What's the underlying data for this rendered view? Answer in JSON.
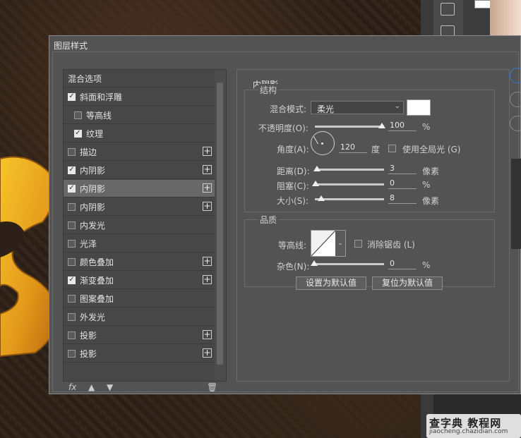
{
  "dialog": {
    "title": "图层样式"
  },
  "style_list": {
    "header": "混合选项",
    "items": [
      {
        "label": "斜面和浮雕",
        "checked": true,
        "plus": false,
        "indent": 0,
        "selected": false
      },
      {
        "label": "等高线",
        "checked": false,
        "plus": false,
        "indent": 1,
        "selected": false
      },
      {
        "label": "纹理",
        "checked": true,
        "plus": false,
        "indent": 1,
        "selected": false
      },
      {
        "label": "描边",
        "checked": false,
        "plus": true,
        "indent": 0,
        "selected": false
      },
      {
        "label": "内阴影",
        "checked": true,
        "plus": true,
        "indent": 0,
        "selected": false
      },
      {
        "label": "内阴影",
        "checked": true,
        "plus": true,
        "indent": 0,
        "selected": true
      },
      {
        "label": "内阴影",
        "checked": false,
        "plus": true,
        "indent": 0,
        "selected": false
      },
      {
        "label": "内发光",
        "checked": false,
        "plus": false,
        "indent": 0,
        "selected": false
      },
      {
        "label": "光泽",
        "checked": false,
        "plus": false,
        "indent": 0,
        "selected": false
      },
      {
        "label": "颜色叠加",
        "checked": false,
        "plus": true,
        "indent": 0,
        "selected": false
      },
      {
        "label": "渐变叠加",
        "checked": true,
        "plus": true,
        "indent": 0,
        "selected": false
      },
      {
        "label": "图案叠加",
        "checked": false,
        "plus": false,
        "indent": 0,
        "selected": false
      },
      {
        "label": "外发光",
        "checked": false,
        "plus": false,
        "indent": 0,
        "selected": false
      },
      {
        "label": "投影",
        "checked": false,
        "plus": true,
        "indent": 0,
        "selected": false
      },
      {
        "label": "投影",
        "checked": false,
        "plus": true,
        "indent": 0,
        "selected": false
      }
    ],
    "footer": {
      "fx_label": "fx",
      "up_icon": "arrow-up-icon",
      "down_icon": "arrow-down-icon",
      "trash_icon": "trash-icon"
    }
  },
  "inner_shadow": {
    "section_title": "内阴影",
    "structure_title": "结构",
    "blend_mode_label": "混合模式:",
    "blend_mode_value": "柔光",
    "blend_color": "#ffffff",
    "opacity_label": "不透明度(O):",
    "opacity_value": "100",
    "opacity_unit": "%",
    "angle_label": "角度(A):",
    "angle_value": "120",
    "angle_unit": "度",
    "global_light_label": "使用全局光 (G)",
    "global_light_checked": false,
    "distance_label": "距离(D):",
    "distance_value": "3",
    "distance_unit": "像素",
    "choke_label": "阻塞(C):",
    "choke_value": "0",
    "choke_unit": "%",
    "size_label": "大小(S):",
    "size_value": "8",
    "size_unit": "像素",
    "quality_title": "品质",
    "contour_label": "等高线:",
    "anti_alias_label": "消除锯齿 (L)",
    "anti_alias_checked": false,
    "noise_label": "杂色(N):",
    "noise_value": "0",
    "noise_unit": "%",
    "set_default_label": "设置为默认值",
    "reset_default_label": "复位为默认值"
  },
  "watermark": {
    "title": "查字典 教程网",
    "url": "jiaocheng.chazidian.com"
  }
}
